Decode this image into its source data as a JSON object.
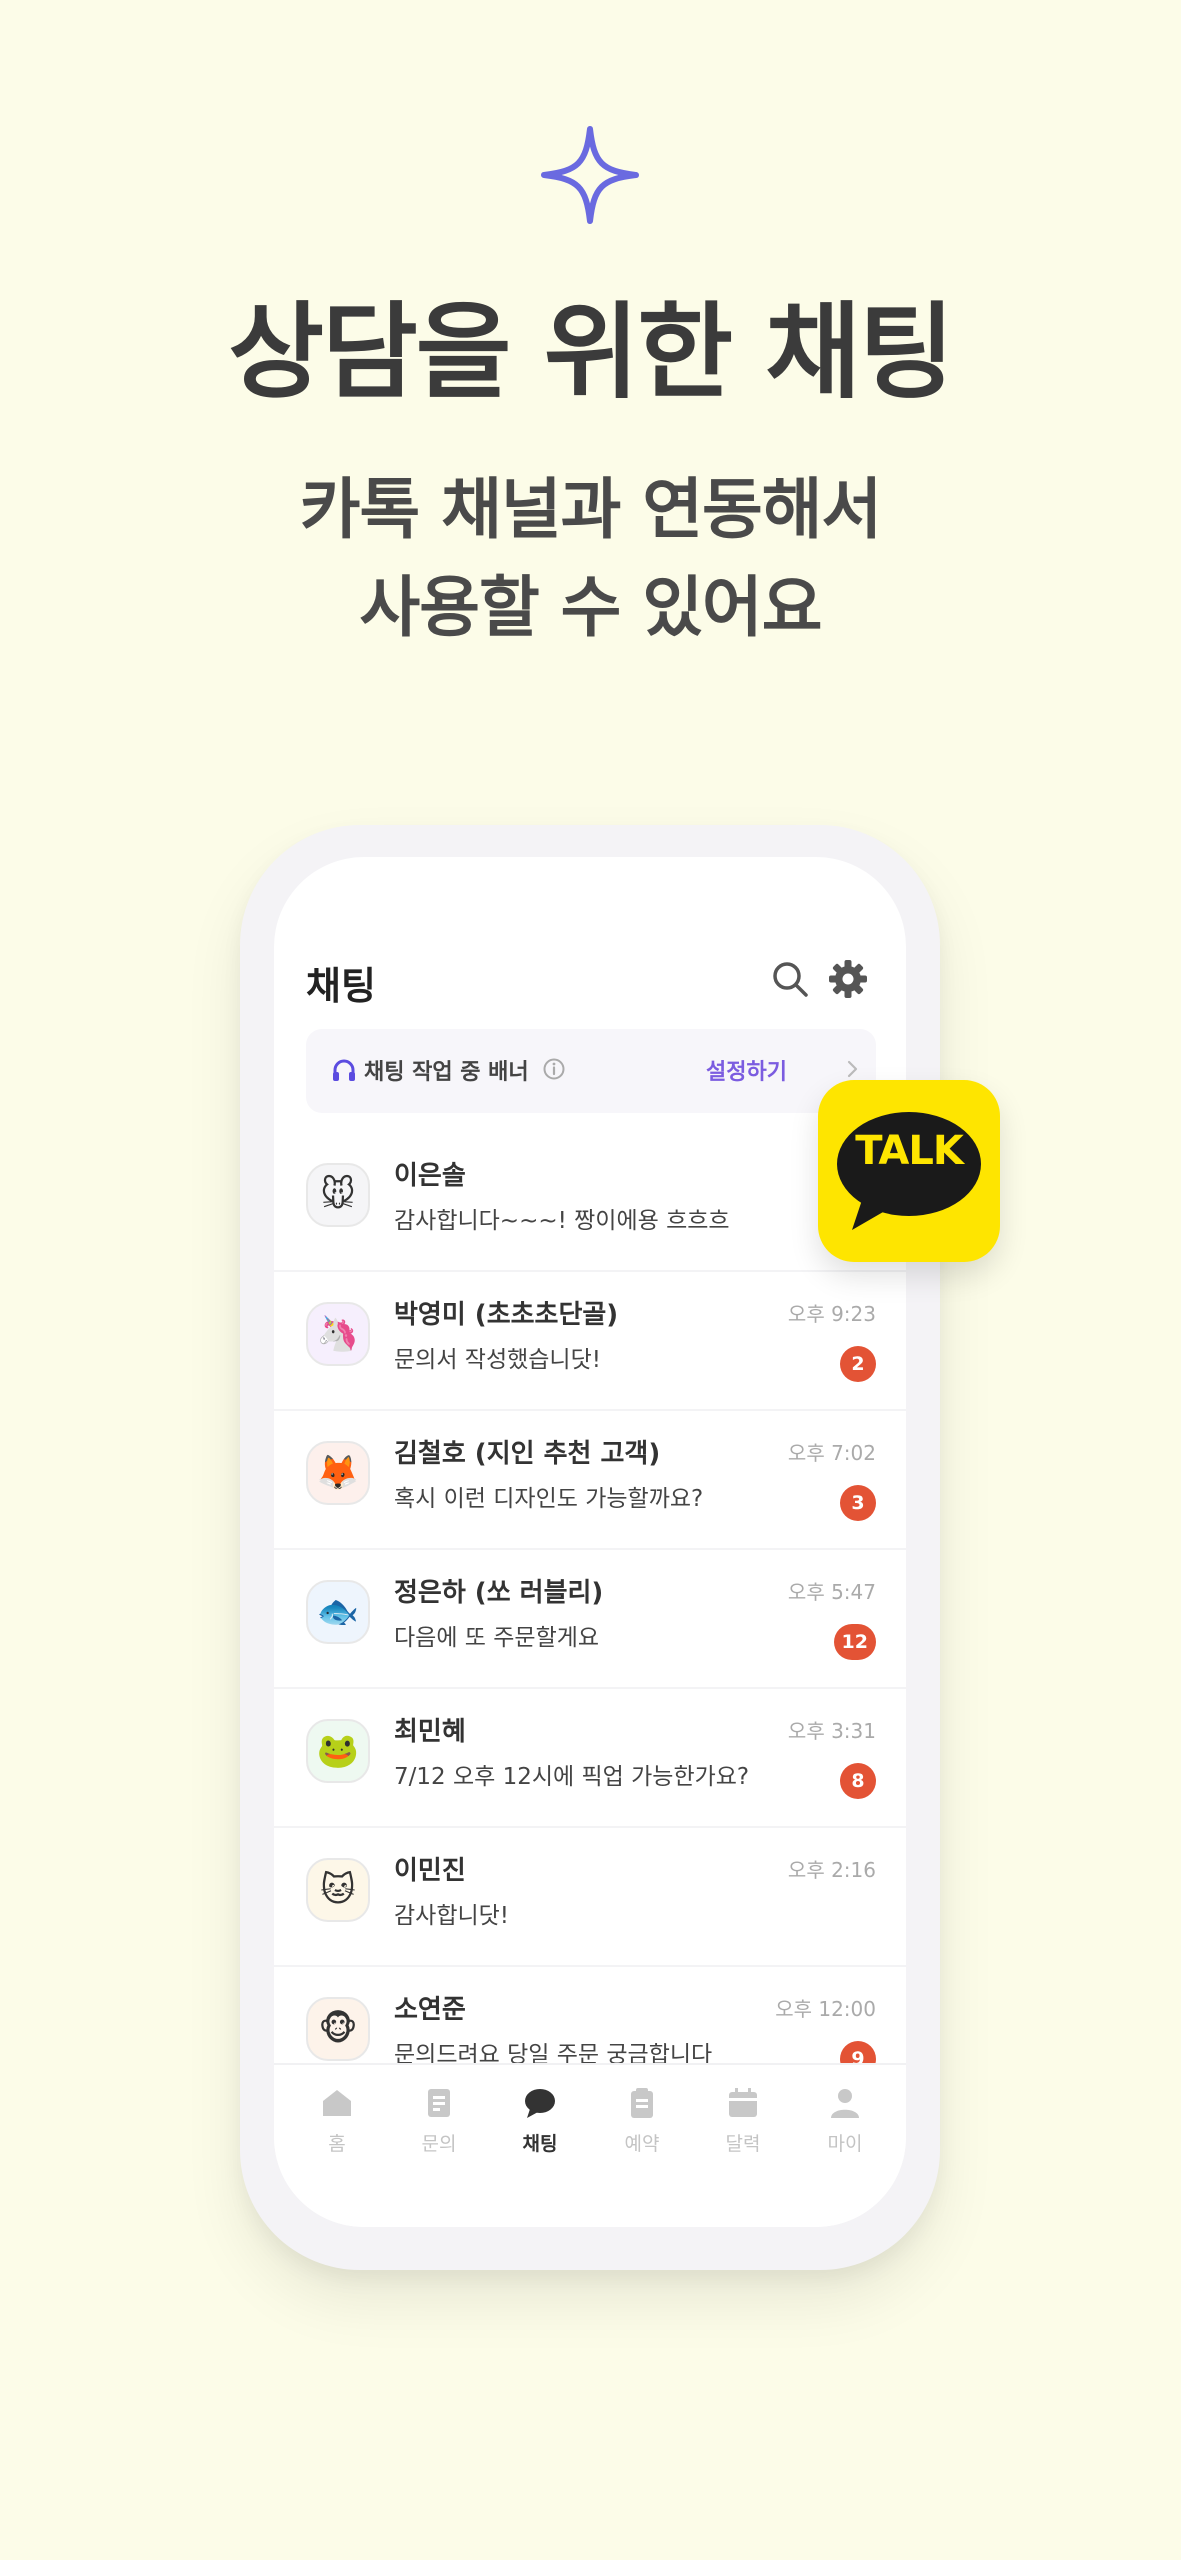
{
  "headline": "상담을 위한 채팅",
  "subline_1": "카톡 채널과 연동해서",
  "subline_2": "사용할 수 있어요",
  "colors": {
    "background": "#fcfce8",
    "sparkle": "#6a6ae0",
    "badge": "#e35335",
    "banner_action": "#7b5ce0",
    "kakao_yellow": "#fee500"
  },
  "screen": {
    "title": "채팅",
    "search_icon": "search-icon",
    "settings_icon": "gear-icon"
  },
  "banner": {
    "label": "채팅 작업 중 배너",
    "action": "설정하기"
  },
  "chats": [
    {
      "emoji": "🐭",
      "avatar_bg": "#f5f5f7",
      "name": "이은솔",
      "message": "감사합니다~~~! 짱이에용 흐흐흐",
      "time": "오후 ",
      "badge": ""
    },
    {
      "emoji": "🦄",
      "avatar_bg": "#f6effd",
      "name": "박영미 (초초초단골)",
      "message": "문의서 작성했습니닷!",
      "time": "오후 9:23",
      "badge": "2"
    },
    {
      "emoji": "🦊",
      "avatar_bg": "#fdf0ec",
      "name": "김철호 (지인 추천 고객)",
      "message": "혹시 이런 디자인도 가능할까요?",
      "time": "오후 7:02",
      "badge": "3"
    },
    {
      "emoji": "🐟",
      "avatar_bg": "#eef5fd",
      "name": "정은하 (쏘 러블리)",
      "message": "다음에 또 주문할게요",
      "time": "오후 5:47",
      "badge": "12"
    },
    {
      "emoji": "🐸",
      "avatar_bg": "#eef9f1",
      "name": "최민혜",
      "message": "7/12 오후 12시에 픽업 가능한가요?",
      "time": "오후 3:31",
      "badge": "8"
    },
    {
      "emoji": "🐱",
      "avatar_bg": "#fdf7e8",
      "name": "이민진",
      "message": "감사합니닷!",
      "time": "오후 2:16",
      "badge": ""
    },
    {
      "emoji": "🐵",
      "avatar_bg": "#fdf3ea",
      "name": "소연준",
      "message": "문의드려요 당일 주문 궁금합니다",
      "time": "오후 12:00",
      "badge": "9"
    }
  ],
  "tabs": [
    {
      "label": "홈",
      "icon": "home-icon"
    },
    {
      "label": "문의",
      "icon": "document-icon"
    },
    {
      "label": "채팅",
      "icon": "chat-bubble-icon",
      "active": true
    },
    {
      "label": "예약",
      "icon": "clipboard-icon"
    },
    {
      "label": "달력",
      "icon": "calendar-icon"
    },
    {
      "label": "마이",
      "icon": "person-icon"
    }
  ],
  "talk_logo": {
    "text": "TALK"
  }
}
